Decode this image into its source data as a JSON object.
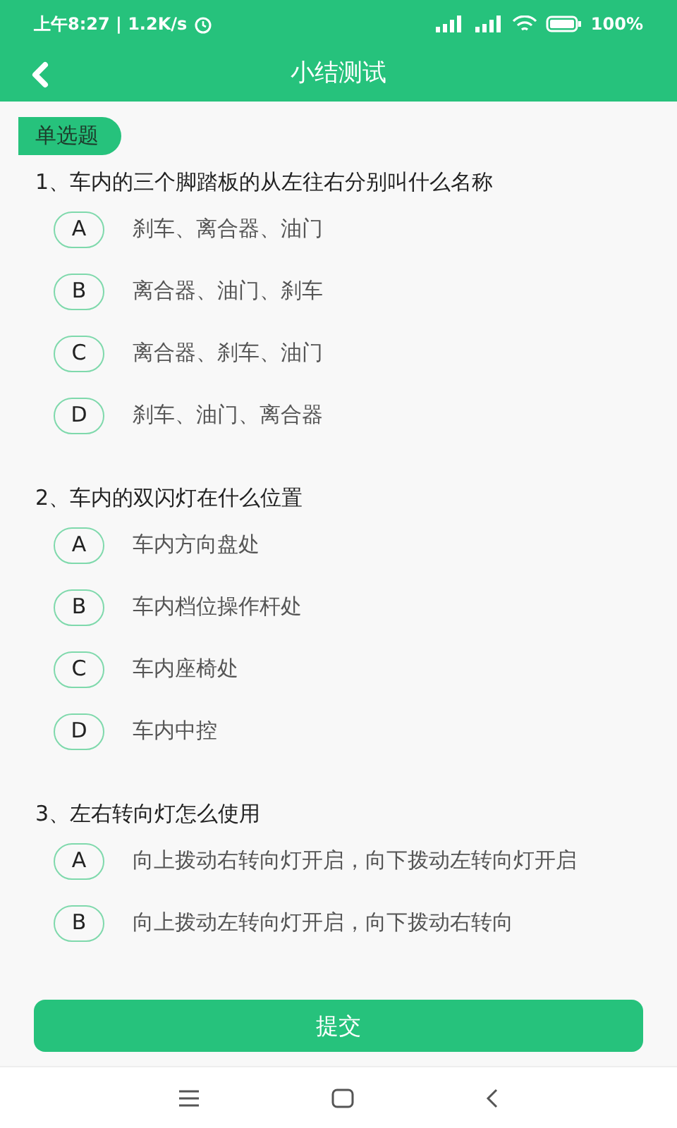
{
  "status_bar": {
    "time": "上午8:27 | 1.2K/s",
    "battery": "100%"
  },
  "header": {
    "title": "小结测试"
  },
  "section_tag": "单选题",
  "questions": [
    {
      "title": "1、车内的三个脚踏板的从左往右分别叫什么名称",
      "options": [
        {
          "letter": "A",
          "text": "刹车、离合器、油门",
          "selected": false
        },
        {
          "letter": "B",
          "text": "离合器、油门、刹车",
          "selected": false
        },
        {
          "letter": "C",
          "text": "离合器、刹车、油门",
          "selected": false
        },
        {
          "letter": "D",
          "text": "刹车、油门、离合器",
          "selected": false
        }
      ]
    },
    {
      "title": "2、车内的双闪灯在什么位置",
      "options": [
        {
          "letter": "A",
          "text": "车内方向盘处",
          "selected": false
        },
        {
          "letter": "B",
          "text": "车内档位操作杆处",
          "selected": false
        },
        {
          "letter": "C",
          "text": "车内座椅处",
          "selected": false
        },
        {
          "letter": "D",
          "text": "车内中控",
          "selected": false
        }
      ]
    },
    {
      "title": "3、左右转向灯怎么使用",
      "options": [
        {
          "letter": "A",
          "text": "向上拨动右转向灯开启，向下拨动左转向灯开启",
          "selected": false
        },
        {
          "letter": "B",
          "text": "向上拨动左转向灯开启，向下拨动右转向",
          "selected": false
        }
      ]
    }
  ],
  "submit_button": "提交"
}
